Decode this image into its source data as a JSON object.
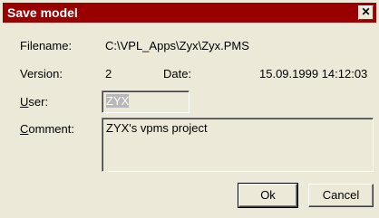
{
  "dialog": {
    "title": "Save model",
    "close_glyph": "✕"
  },
  "fields": {
    "filename_label": "Filename:",
    "filename_value": "C:\\VPL_Apps\\Zyx\\Zyx.PMS",
    "version_label": "Version:",
    "version_value": "2",
    "date_label": "Date:",
    "date_value": "15.09.1999 14:12:03",
    "user_label_ul": "U",
    "user_label_rest": "ser:",
    "user_value": "ZYX",
    "comment_label_ul": "C",
    "comment_label_rest": "omment:",
    "comment_value": "ZYX's vpms project"
  },
  "buttons": {
    "ok_label": "Ok",
    "cancel_label": "Cancel"
  }
}
